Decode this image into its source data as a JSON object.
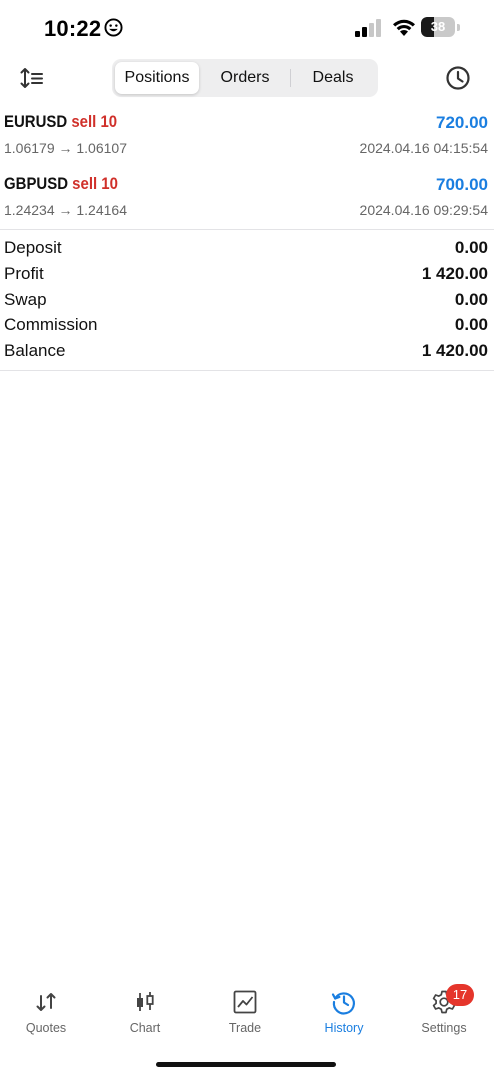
{
  "status_bar": {
    "time": "10:22",
    "battery_level": "38",
    "battery_fraction": 0.38,
    "icons": [
      "emoji-icon",
      "cellular-signal-icon",
      "wifi-icon",
      "battery-icon"
    ]
  },
  "toolbar": {
    "sort_icon": "sort-icon",
    "segments": [
      {
        "label": "Positions",
        "active": true
      },
      {
        "label": "Orders",
        "active": false
      },
      {
        "label": "Deals",
        "active": false
      }
    ],
    "history_icon": "clock-icon"
  },
  "deals": [
    {
      "symbol": "EURUSD",
      "action": "sell 10",
      "profit": "720.00",
      "prices": "1.06179 → 1.06107",
      "time": "2024.04.16 04:15:54"
    },
    {
      "symbol": "GBPUSD",
      "action": "sell 10",
      "profit": "700.00",
      "prices": "1.24234 → 1.24164",
      "time": "2024.04.16 09:29:54"
    }
  ],
  "summary": [
    {
      "label": "Deposit",
      "value": "0.00"
    },
    {
      "label": "Profit",
      "value": "1 420.00"
    },
    {
      "label": "Swap",
      "value": "0.00"
    },
    {
      "label": "Commission",
      "value": "0.00"
    },
    {
      "label": "Balance",
      "value": "1 420.00"
    }
  ],
  "tabbar": {
    "tabs": [
      {
        "label": "Quotes",
        "icon": "quotes-icon",
        "active": false
      },
      {
        "label": "Chart",
        "icon": "candlestick-icon",
        "active": false
      },
      {
        "label": "Trade",
        "icon": "trade-chart-icon",
        "active": false
      },
      {
        "label": "History",
        "icon": "history-icon",
        "active": true
      },
      {
        "label": "Settings",
        "icon": "gear-icon",
        "active": false
      }
    ],
    "settings_badge": "17"
  },
  "colors": {
    "accent": "#1a7ee0",
    "sell": "#d0302a",
    "badge": "#e5352b"
  }
}
